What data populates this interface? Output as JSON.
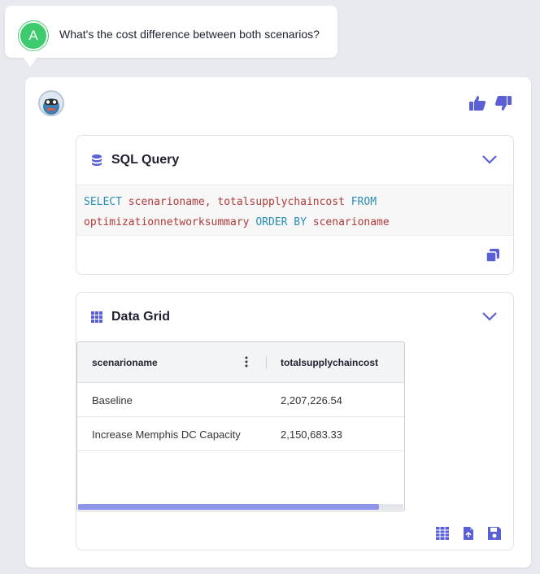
{
  "user_message": {
    "avatar_letter": "A",
    "text": "What's the cost difference between both scenarios?"
  },
  "answer": {
    "feedback": {
      "thumbs_up": "thumbs-up-icon",
      "thumbs_down": "thumbs-down-icon"
    },
    "sql_panel": {
      "title": "SQL Query",
      "query_line1_kw1": "SELECT",
      "query_line1_rest": " scenarioname, totalsupplychaincost ",
      "query_line1_kw2": "FROM",
      "query_line2_table": "optimizationnetworksummary ",
      "query_line2_kw": "ORDER BY",
      "query_line2_col": " scenarioname"
    },
    "grid_panel": {
      "title": "Data Grid",
      "columns": [
        "scenarioname",
        "totalsupplychaincost"
      ],
      "rows": [
        [
          "Baseline",
          "2,207,226.54"
        ],
        [
          "Increase Memphis DC Capacity",
          "2,150,683.33"
        ]
      ]
    }
  },
  "colors": {
    "accent": "#5a5fd6",
    "user_avatar": "#3ecb6e",
    "sql_keyword": "#2a8fb3",
    "sql_identifier": "#b03a3a"
  }
}
